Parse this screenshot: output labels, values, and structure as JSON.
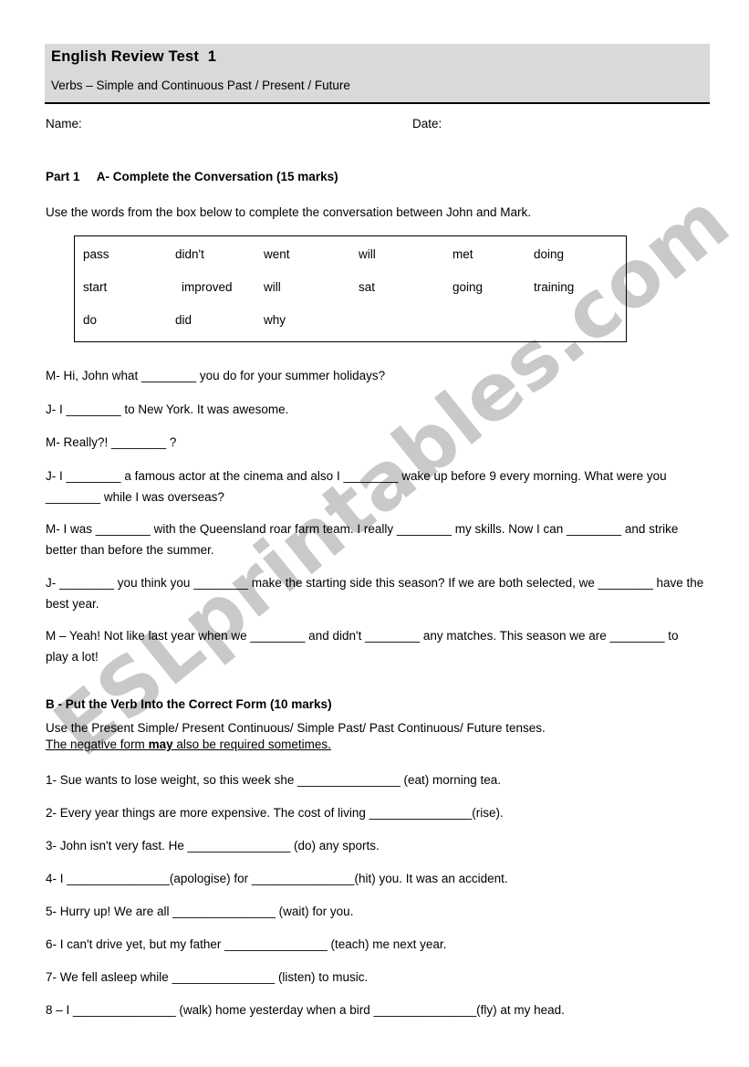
{
  "document": {
    "title": "English Review Test  1",
    "subtitle": "Verbs – Simple and Continuous Past / Present / Future",
    "name_label": "Name:",
    "date_label": "Date:",
    "watermark": "ESLprintables.com",
    "header_bg": "#d9d9d9"
  },
  "part1": {
    "heading": "Part 1     A- Complete the Conversation (15 marks)",
    "instruction": "Use the words from the box below to complete the conversation between John and Mark.",
    "word_bank": {
      "rows": [
        [
          "pass",
          "didn't",
          "went",
          "will",
          "met",
          "doing"
        ],
        [
          "start",
          "improved",
          "will",
          "sat",
          "going",
          "training"
        ],
        [
          "do",
          "did",
          "why",
          "",
          "",
          ""
        ]
      ]
    },
    "conversation": [
      "M- Hi, John what ________ you do for your summer holidays?",
      "J- I ________ to New York.  It was awesome.",
      "M- Really?! ________ ?",
      "J- I ________ a famous actor at the cinema and also I ________ wake up before 9  every morning. What were you ________ while I was overseas?",
      "M- I was ________ with the Queensland roar farm team.  I really ________ my skills.  Now I can ________ and strike better than before the summer.",
      "J- ________ you think you ________ make the starting side this season? If we are both selected, we ________ have the best year.",
      "M – Yeah!  Not like last year when we ________ and didn't ________ any matches.  This season we are ________ to play a lot!"
    ]
  },
  "partB": {
    "heading": "B - Put the Verb Into the Correct Form (10 marks)",
    "instruction_line1": "Use the Present Simple/ Present Continuous/ Simple Past/ Past Continuous/ Future tenses.",
    "instruction_line2_pre": "The negative form ",
    "instruction_line2_bold": "may",
    "instruction_line2_post": " also be required sometimes.",
    "items": [
      "1- Sue wants to lose weight, so this week she _______________ (eat) morning tea.",
      "2- Every year things are more expensive. The cost of living _______________(rise).",
      "3- John isn't very fast.  He _______________ (do) any sports.",
      "4- I _______________(apologise) for _______________(hit) you. It was an accident.",
      "5- Hurry up! We are all _______________ (wait) for you.",
      "6- I can't drive yet, but my father _______________ (teach) me next year.",
      "7- We fell asleep while _______________ (listen) to music.",
      "8 – I _______________ (walk) home yesterday when a bird _______________(fly) at my head."
    ]
  }
}
